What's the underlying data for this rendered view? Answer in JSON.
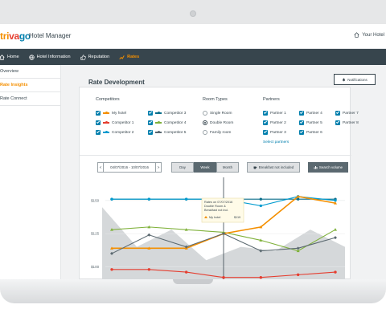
{
  "app": {
    "logo_part1": "tri",
    "logo_part2": "va",
    "logo_part3": "go",
    "name": "Hotel Manager",
    "your_hotel": "Your Hotel"
  },
  "nav": [
    {
      "label": "Home",
      "icon": "home-icon"
    },
    {
      "label": "Hotel Information",
      "icon": "globe-icon"
    },
    {
      "label": "Reputation",
      "icon": "thumbs-up-icon"
    },
    {
      "label": "Rates",
      "icon": "rates-icon",
      "active": true
    }
  ],
  "sidebar": [
    {
      "label": "Overview"
    },
    {
      "label": "Rate Insights",
      "active": true
    },
    {
      "label": "Rate Connect"
    }
  ],
  "page": {
    "title": "Rate Development",
    "notifications_label": "Notifications"
  },
  "filters": {
    "competitors_title": "Competitors",
    "competitors": [
      {
        "label": "My hotel",
        "color": "#f48f00"
      },
      {
        "label": "Competitor 1",
        "color": "#e53e30"
      },
      {
        "label": "Competitor 2",
        "color": "#009bcf"
      },
      {
        "label": "Competitor 3",
        "color": "#0b6f8c"
      },
      {
        "label": "Competitor 4",
        "color": "#7fb13a"
      },
      {
        "label": "Competitor 5",
        "color": "#5b6970"
      }
    ],
    "room_types_title": "Room Types",
    "room_types": [
      {
        "label": "Single Room",
        "selected": false
      },
      {
        "label": "Double Room",
        "selected": true
      },
      {
        "label": "Family room",
        "selected": false
      }
    ],
    "partners_title": "Partners",
    "partners": [
      "Partner 1",
      "Partner 2",
      "Partner 3",
      "Partner 4",
      "Partner 5",
      "Partner 6",
      "Partner 7",
      "Partner 8"
    ],
    "select_partners": "Select partners"
  },
  "controls": {
    "date_range": "04/07/2016 - 10/07/2016",
    "prev": "<",
    "next": ">",
    "day": "Day",
    "week": "Week",
    "month": "Month",
    "breakfast": "Breakfast not included",
    "search_volume": "Search volume",
    "help": "(?)"
  },
  "chart_data": {
    "type": "line",
    "x": [
      1,
      2,
      3,
      4,
      5,
      6,
      7
    ],
    "ytick_labels": [
      "$150",
      "$125",
      "$100"
    ],
    "ylim": [
      90,
      165
    ],
    "series": [
      {
        "key": "competitor-3",
        "color": "#0b6f8c",
        "values": [
          151,
          151,
          151,
          151,
          151,
          151,
          151
        ]
      },
      {
        "key": "competitor-2",
        "color": "#009bcf",
        "values": [
          151,
          151,
          151,
          151,
          146,
          153,
          150
        ]
      },
      {
        "key": "competitor-4",
        "color": "#7fb13a",
        "values": [
          128,
          130,
          128,
          126,
          120,
          112,
          128
        ]
      },
      {
        "key": "my-hotel",
        "color": "#f48f00",
        "values": [
          114,
          114,
          114,
          125,
          130,
          153,
          148
        ]
      },
      {
        "key": "competitor-5",
        "color": "#5b6970",
        "values": [
          110,
          124,
          115,
          125,
          112,
          114,
          122
        ]
      },
      {
        "key": "competitor-1",
        "color": "#e53e30",
        "values": [
          98,
          98,
          96,
          92,
          92,
          94,
          96
        ]
      }
    ],
    "search_volume": [
      145,
      115,
      128,
      105,
      115,
      112,
      128,
      115
    ],
    "tooltip": {
      "title": "Rates on 07/07/2016",
      "line2": "Double Room &",
      "line3": "Breakfast not incl.",
      "label": "My hotel",
      "value": "$119"
    }
  }
}
